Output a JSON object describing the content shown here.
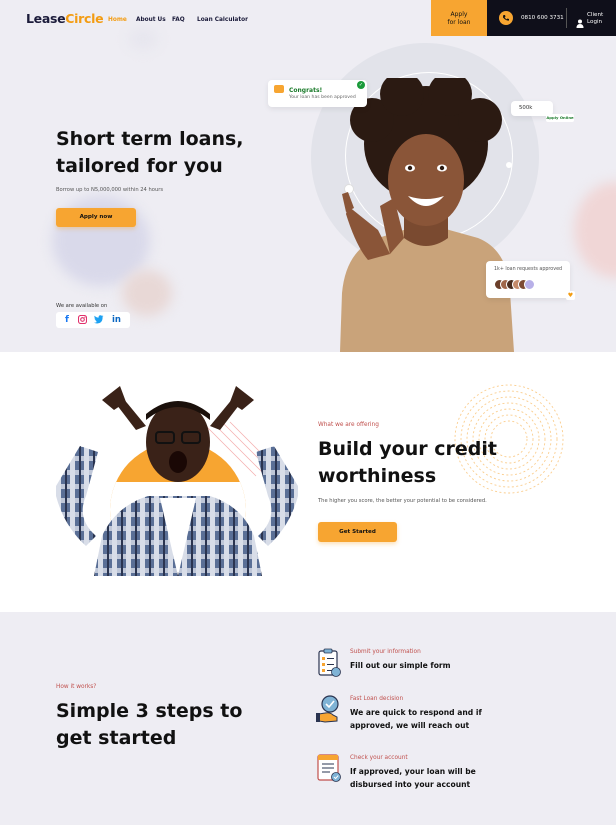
{
  "header": {
    "logo_main": "Lease",
    "logo_accent": "Circle",
    "nav": [
      "Home",
      "About Us",
      "FAQ",
      "Loan Calculator"
    ],
    "apply_line1": "Apply",
    "apply_line2": "for loan",
    "phone": "0810 600 3731",
    "client_line1": "Client",
    "client_line2": "Login"
  },
  "hero": {
    "title_line1": "Short term loans,",
    "title_line2": "tailored for you",
    "subtitle": "Borrow up to N5,000,000 within 24 hours",
    "cta": "Apply now",
    "available_label": "We are available on",
    "social_icons": [
      "facebook-icon",
      "instagram-icon",
      "twitter-icon",
      "linkedin-icon"
    ],
    "congrats_title": "Congrats!",
    "congrats_text": "Your loan has been approved",
    "amount": "500k",
    "amount_tag": "Apply Online",
    "requests_text": "1k+  loan requests approved"
  },
  "credit": {
    "label": "What we are offering",
    "title_line1": "Build your credit",
    "title_line2": "worthiness",
    "subtitle": "The higher you score, the better your potential to be considered.",
    "cta": "Get Started"
  },
  "steps": {
    "label": "How it works?",
    "title_line1": "Simple 3 steps to",
    "title_line2": "get started",
    "items": [
      {
        "label": "Submit your information",
        "title_line1": "Fill out our simple form",
        "title_line2": "",
        "icon": "form-icon"
      },
      {
        "label": "Fast Loan decision",
        "title_line1": "We are quick to respond and if",
        "title_line2": "approved, we will reach out",
        "icon": "decision-icon"
      },
      {
        "label": "Check your account",
        "title_line1": "If approved, your loan will be",
        "title_line2": "disbursed into your account",
        "icon": "account-icon"
      }
    ]
  },
  "colors": {
    "accent": "#f7a531",
    "dark": "#0f0f1a",
    "label_red": "#c0504d",
    "hero_bg": "#eeedf3"
  }
}
